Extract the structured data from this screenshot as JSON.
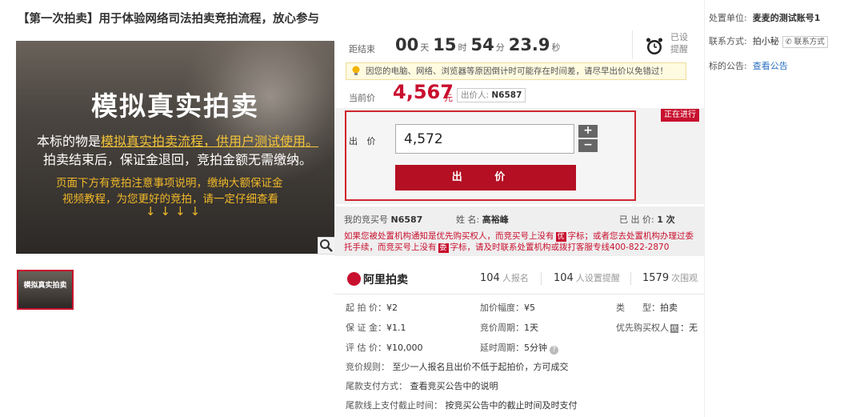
{
  "title": "【第一次拍卖】用于体验网络司法拍卖竞拍流程，放心参与",
  "image": {
    "headline": "模拟真实拍卖",
    "line1_prefix": "本标的物是",
    "line1_highlight": "模拟真实拍卖流程，供用户测试使用。",
    "line2": "拍卖结束后，保证金退回，竞拍金额无需缴纳。",
    "line3": "页面下方有竞拍注意事项说明，缴纳大额保证金",
    "line4": "视频教程，为您更好的竞拍，请一定仔细查看",
    "arrows": "↓↓↓↓",
    "thumb_text": "模拟真实拍卖"
  },
  "countdown": {
    "label": "距结束",
    "days": "00",
    "days_unit": "天",
    "hours": "15",
    "hours_unit": "时",
    "minutes": "54",
    "minutes_unit": "分",
    "seconds": "23.9",
    "seconds_unit": "秒",
    "reminder_line1": "已设",
    "reminder_line2": "提醒"
  },
  "notice": "因您的电脑、网络、浏览器等原因倒计时可能存在时间差，请尽早出价以免错过！",
  "current_price": {
    "label": "当前价",
    "value": "4,567",
    "unit": "元",
    "bidder_label": "出价人:",
    "bidder": "N6587"
  },
  "status_tag": "正在进行",
  "bid": {
    "label": "出 价",
    "value": "4,572",
    "plus": "+",
    "minus": "−",
    "button": "出 价"
  },
  "my_info": {
    "number_label": "我的竞买号",
    "number": "N6587",
    "name_label": "姓 名:",
    "name": "高裕峰",
    "bids_label": "已 出 价:",
    "bids": "1 次",
    "warn_part1": "如果您被处置机构通知是优先购买权人，而竞买号上没有",
    "warn_tag1": "优",
    "warn_part2": "字标；或者您去处置机构办理过委托手续，而竞买号上没有",
    "warn_tag2": "委",
    "warn_part3": "字标，请及时联系处置机构或拨打客服专线400-822-2870"
  },
  "platform": {
    "logo": "阿里拍卖",
    "signups": "104",
    "signups_label": "人报名",
    "reminders": "104",
    "reminders_label": "人设置提醒",
    "views": "1579",
    "views_label": "次围观"
  },
  "details": {
    "start_price_label": "起 拍 价：",
    "start_price": "¥2",
    "increment_label": "加价幅度：",
    "increment": "¥5",
    "type_label": "类　　型：",
    "type": "拍卖",
    "deposit_label": "保 证 金：",
    "deposit": "¥1.1",
    "period_label": "竞价周期：",
    "period": "1天",
    "priority_label": "优先购买权人",
    "priority_tag": "优",
    "priority": "：无",
    "estimate_label": "评 估 价：",
    "estimate": "¥10,000",
    "delay_label": "延时周期：",
    "delay": "5分钟",
    "rule_label": "竞价规则：",
    "rule": "至少一人报名且出价不低于起拍价，方可成交",
    "payment_label": "尾款支付方式：",
    "payment": "查看竞买公告中的说明",
    "deadline_label": "尾款线上支付截止时间：",
    "deadline": "按竞买公告中的截止时间及时支付"
  },
  "sidebar": {
    "unit_label": "处置单位:",
    "unit": "麦麦的测试账号1",
    "contact_label": "联系方式:",
    "contact": "拍小秘",
    "contact_button": "联系方式",
    "announce_label": "标的公告:",
    "announce_link": "查看公告"
  }
}
